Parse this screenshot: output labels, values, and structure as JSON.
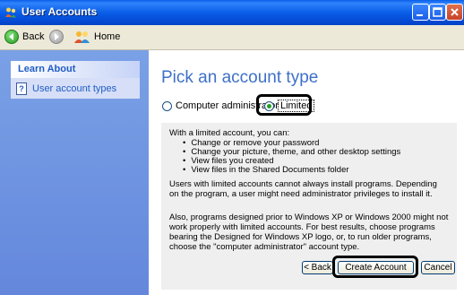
{
  "window": {
    "title": "User Accounts",
    "controls": [
      "minimize",
      "maximize",
      "close"
    ]
  },
  "toolbar": {
    "back_label": "Back",
    "home_label": "Home"
  },
  "sidebar": {
    "learn_about": {
      "title": "Learn About",
      "items": [
        {
          "label": "User account types",
          "icon": "help-icon"
        }
      ]
    }
  },
  "main": {
    "heading": "Pick an account type",
    "options": [
      {
        "label": "Computer administrator",
        "selected": false
      },
      {
        "label": "Limited",
        "selected": true
      }
    ],
    "description": {
      "intro": "With a limited account, you can:",
      "bullets": [
        "Change or remove your password",
        "Change your picture, theme, and other desktop settings",
        "View files you created",
        "View files in the Shared Documents folder"
      ],
      "paragraph1": "Users with limited accounts cannot always install programs. Depending on the program, a user might need administrator privileges to install it.",
      "paragraph2": "Also, programs designed prior to Windows XP or Windows 2000 might not work properly with limited accounts. For best results, choose programs bearing the Designed for Windows XP logo, or, to run older programs, choose the \"computer administrator\" account type."
    },
    "buttons": {
      "back": "< Back",
      "create": "Create Account",
      "cancel": "Cancel"
    }
  },
  "colors": {
    "titlebar": "#0a5ee8",
    "sidebar": "#6f94e0",
    "heading": "#3e70c8",
    "link": "#215dc6",
    "info_bg": "#efefef"
  }
}
